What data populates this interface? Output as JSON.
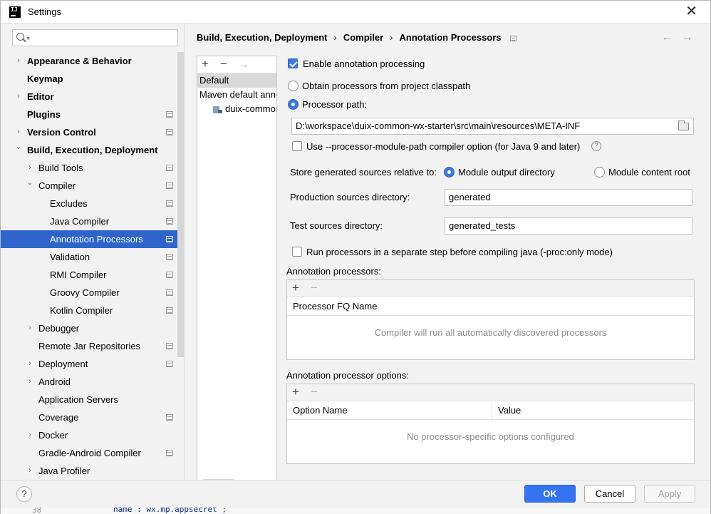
{
  "window": {
    "title": "Settings"
  },
  "search": {
    "placeholder": ""
  },
  "tree": [
    {
      "label": "Appearance & Behavior",
      "level": 0,
      "arrow": "collapsed",
      "bold": true,
      "project": false
    },
    {
      "label": "Keymap",
      "level": 0,
      "arrow": "none",
      "bold": true,
      "project": false
    },
    {
      "label": "Editor",
      "level": 0,
      "arrow": "collapsed",
      "bold": true,
      "project": false
    },
    {
      "label": "Plugins",
      "level": 0,
      "arrow": "none",
      "bold": true,
      "project": true
    },
    {
      "label": "Version Control",
      "level": 0,
      "arrow": "collapsed",
      "bold": true,
      "project": true
    },
    {
      "label": "Build, Execution, Deployment",
      "level": 0,
      "arrow": "expanded",
      "bold": true,
      "project": false
    },
    {
      "label": "Build Tools",
      "level": 1,
      "arrow": "collapsed",
      "bold": false,
      "project": true
    },
    {
      "label": "Compiler",
      "level": 1,
      "arrow": "expanded",
      "bold": false,
      "project": true
    },
    {
      "label": "Excludes",
      "level": 2,
      "arrow": "none",
      "bold": false,
      "project": true
    },
    {
      "label": "Java Compiler",
      "level": 2,
      "arrow": "none",
      "bold": false,
      "project": true
    },
    {
      "label": "Annotation Processors",
      "level": 2,
      "arrow": "none",
      "bold": false,
      "project": true,
      "selected": true
    },
    {
      "label": "Validation",
      "level": 2,
      "arrow": "none",
      "bold": false,
      "project": true
    },
    {
      "label": "RMI Compiler",
      "level": 2,
      "arrow": "none",
      "bold": false,
      "project": true
    },
    {
      "label": "Groovy Compiler",
      "level": 2,
      "arrow": "none",
      "bold": false,
      "project": true
    },
    {
      "label": "Kotlin Compiler",
      "level": 2,
      "arrow": "none",
      "bold": false,
      "project": true
    },
    {
      "label": "Debugger",
      "level": 1,
      "arrow": "collapsed",
      "bold": false,
      "project": false
    },
    {
      "label": "Remote Jar Repositories",
      "level": 1,
      "arrow": "none",
      "bold": false,
      "project": true
    },
    {
      "label": "Deployment",
      "level": 1,
      "arrow": "collapsed",
      "bold": false,
      "project": true
    },
    {
      "label": "Android",
      "level": 1,
      "arrow": "collapsed",
      "bold": false,
      "project": false
    },
    {
      "label": "Application Servers",
      "level": 1,
      "arrow": "none",
      "bold": false,
      "project": false
    },
    {
      "label": "Coverage",
      "level": 1,
      "arrow": "none",
      "bold": false,
      "project": true
    },
    {
      "label": "Docker",
      "level": 1,
      "arrow": "collapsed",
      "bold": false,
      "project": false
    },
    {
      "label": "Gradle-Android Compiler",
      "level": 1,
      "arrow": "none",
      "bold": false,
      "project": true
    },
    {
      "label": "Java Profiler",
      "level": 1,
      "arrow": "collapsed",
      "bold": false,
      "project": false
    }
  ],
  "breadcrumb": [
    "Build, Execution, Deployment",
    "Compiler",
    "Annotation Processors"
  ],
  "profiles": {
    "items": [
      {
        "label": "Default",
        "selected": true
      },
      {
        "label": "Maven default annotation processors profile",
        "selected": false
      },
      {
        "label": "duix-common-wx-starter",
        "selected": false,
        "module": true
      }
    ]
  },
  "form": {
    "enable_processing": {
      "label": "Enable annotation processing",
      "checked": true
    },
    "obtain_classpath": {
      "label": "Obtain processors from project classpath",
      "checked": false
    },
    "processor_path": {
      "label": "Processor path:",
      "checked": true,
      "value": "D:\\workspace\\duix-common-wx-starter\\src\\main\\resources\\META-INF"
    },
    "module_path_option": {
      "label": "Use --processor-module-path compiler option (for Java 9 and later)",
      "checked": false
    },
    "store_relative": {
      "label": "Store generated sources relative to:",
      "option_output": "Module output directory",
      "option_content": "Module content root",
      "selected": "Module output directory"
    },
    "production_dir": {
      "label": "Production sources directory:",
      "value": "generated"
    },
    "test_dir": {
      "label": "Test sources directory:",
      "value": "generated_tests"
    },
    "separate_step": {
      "label": "Run processors in a separate step before compiling java (-proc:only mode)",
      "checked": false
    }
  },
  "processors_table": {
    "title": "Annotation processors:",
    "column": "Processor FQ Name",
    "empty": "Compiler will run all automatically discovered processors"
  },
  "options_table": {
    "title": "Annotation processor options:",
    "columns": [
      "Option Name",
      "Value"
    ],
    "empty": "No processor-specific options configured"
  },
  "buttons": {
    "help": "?",
    "ok": "OK",
    "cancel": "Cancel",
    "apply": "Apply"
  },
  "toolbar": {
    "add": "+",
    "remove": "−",
    "move": "→"
  },
  "nav": {
    "back": "←",
    "forward": "→"
  },
  "icons": {
    "app": "IJ",
    "close": "✕",
    "help": "?"
  },
  "editor_peek": {
    "line_number": "38",
    "code": "name : wx.mp.appsecret ;"
  }
}
